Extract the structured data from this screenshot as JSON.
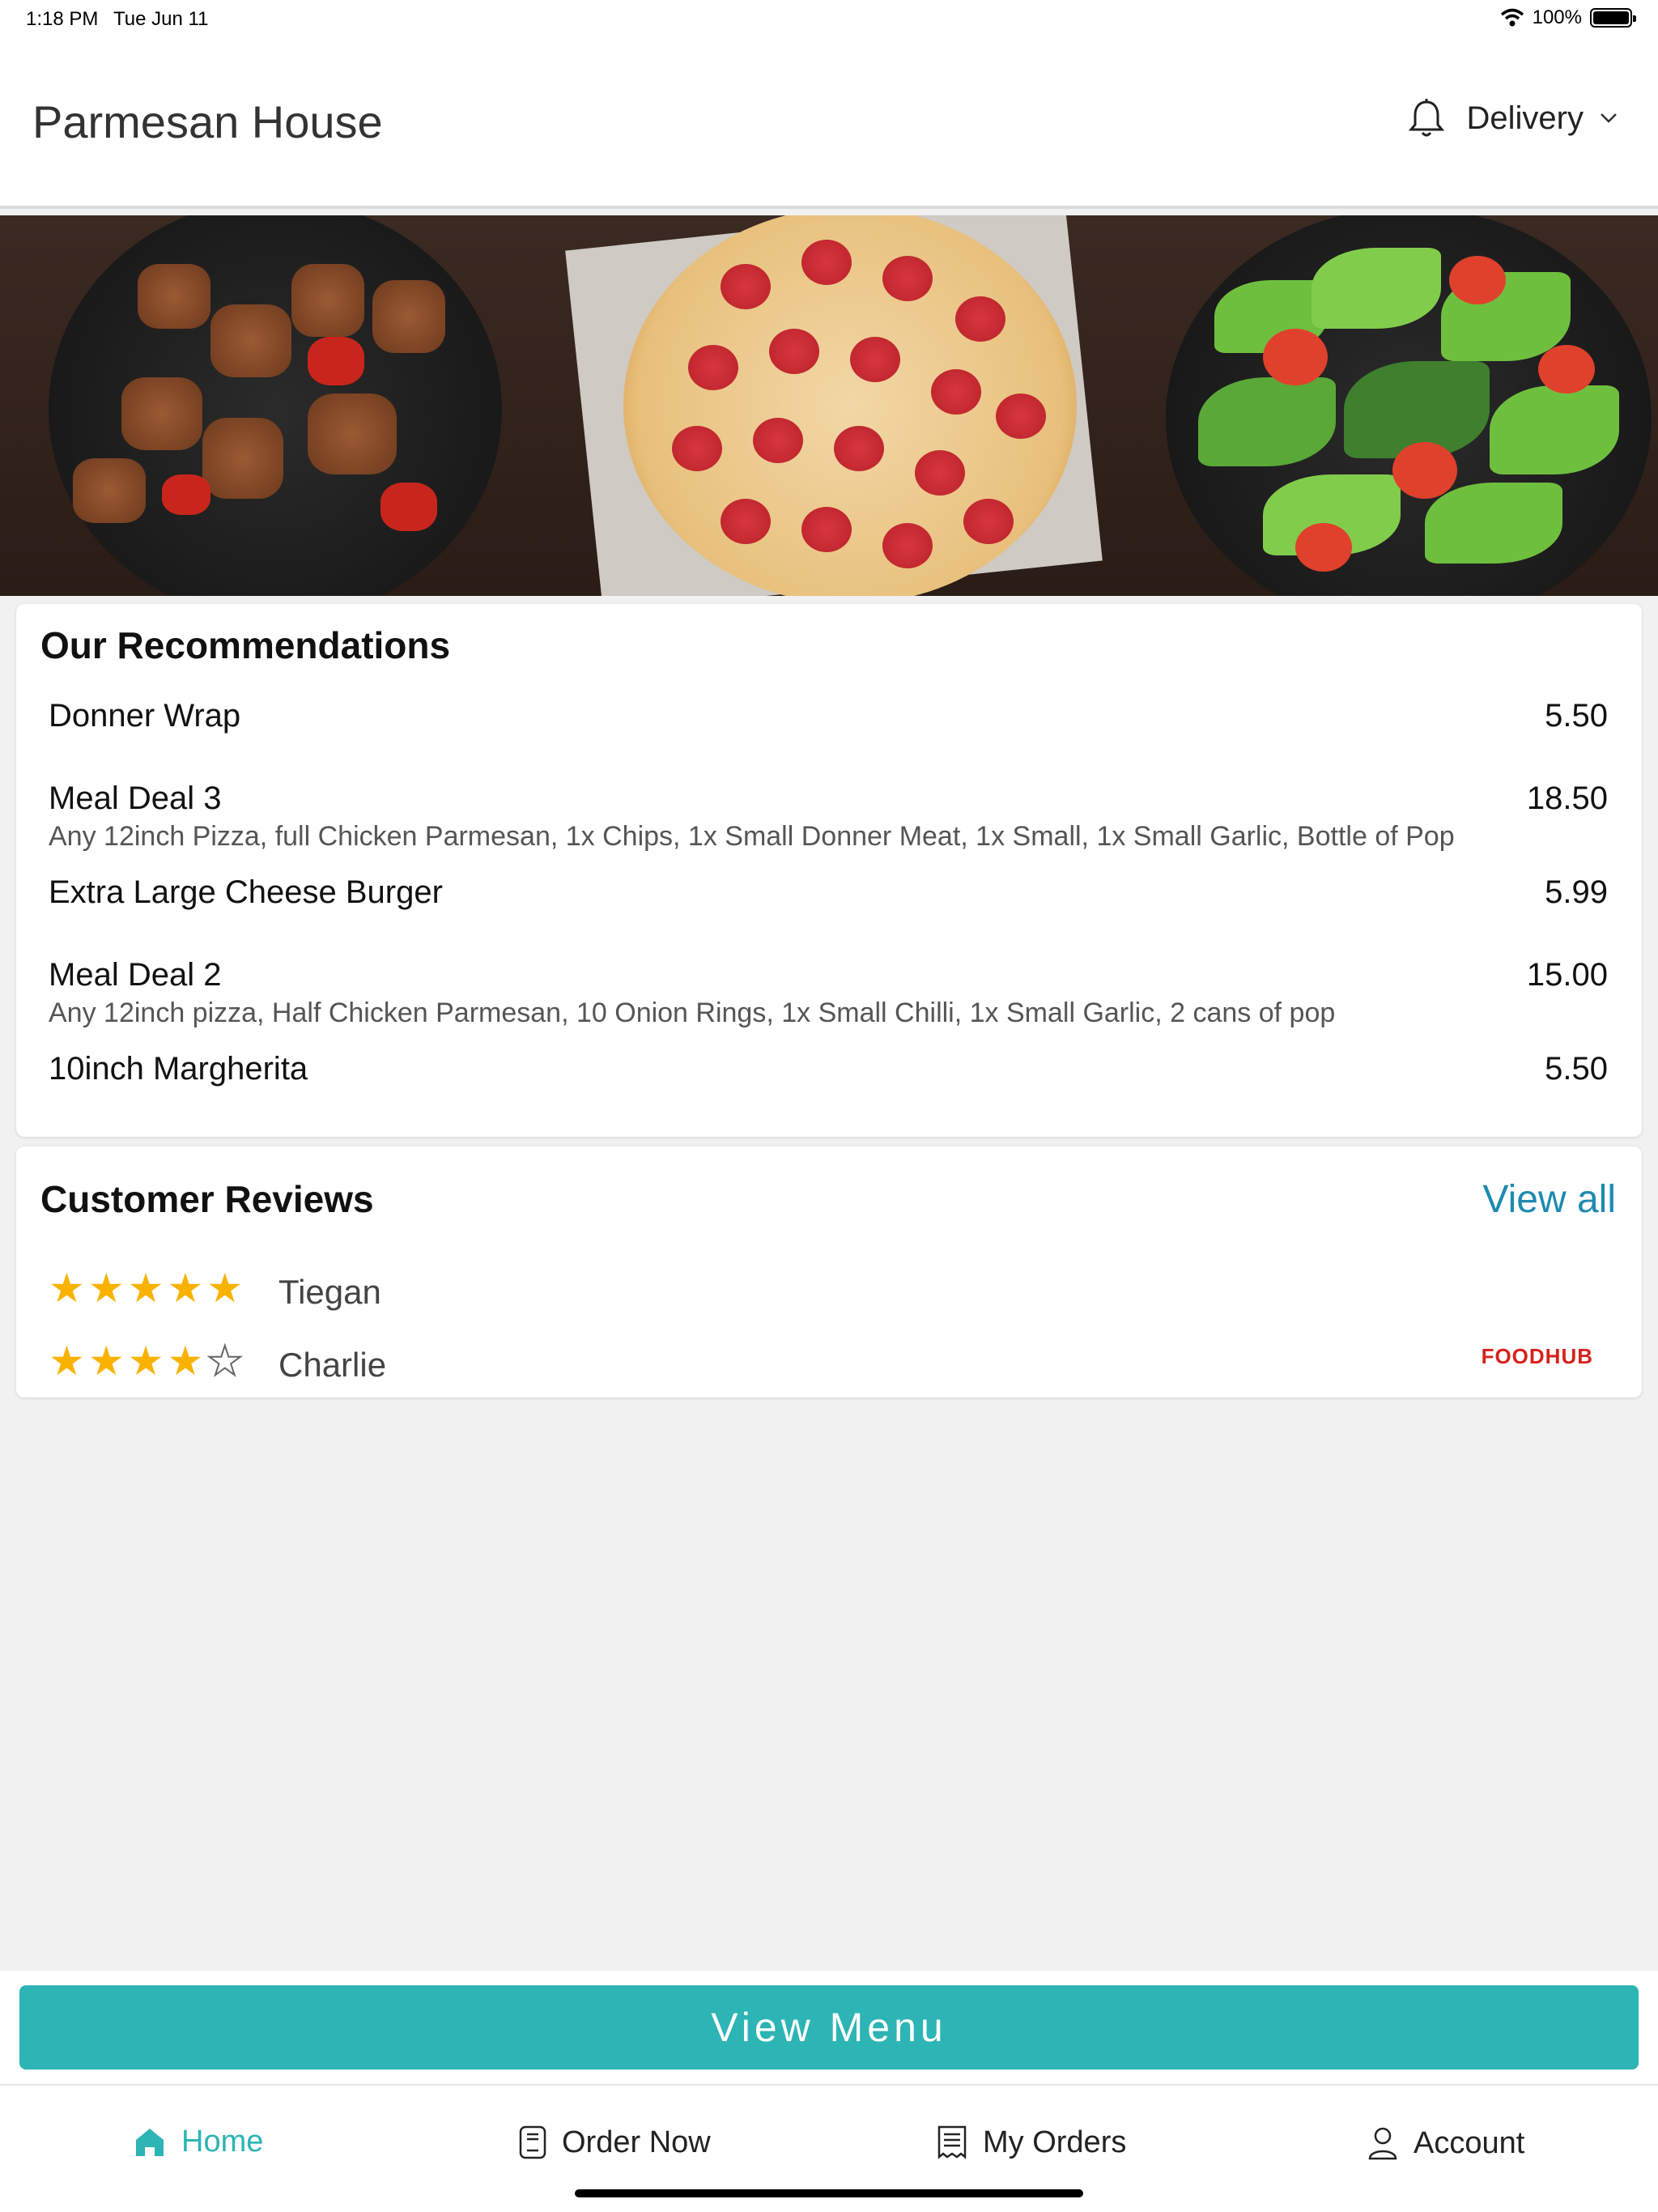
{
  "status_bar": {
    "time": "1:18 PM",
    "date": "Tue Jun 11",
    "battery": "100%"
  },
  "header": {
    "title": "Parmesan House",
    "mode": "Delivery",
    "icons": [
      "bell-icon",
      "chevron-down-icon"
    ]
  },
  "banner": {
    "dishes": [
      "kebab-skewers",
      "pepperoni-pizza",
      "salad"
    ]
  },
  "recommendations": {
    "title": "Our Recommendations",
    "items": [
      {
        "name": "Donner Wrap",
        "price": "5.50",
        "desc": ""
      },
      {
        "name": "Meal Deal 3",
        "price": "18.50",
        "desc": "Any 12inch Pizza, full Chicken Parmesan, 1x Chips, 1x Small Donner Meat, 1x Small, 1x Small Garlic, Bottle of Pop"
      },
      {
        "name": "Extra Large Cheese Burger",
        "price": "5.99",
        "desc": ""
      },
      {
        "name": "Meal Deal 2",
        "price": "15.00",
        "desc": "Any 12inch pizza, Half Chicken Parmesan, 10 Onion Rings, 1x Small Chilli, 1x Small Garlic, 2 cans of pop"
      },
      {
        "name": "10inch Margherita",
        "price": "5.50",
        "desc": ""
      }
    ]
  },
  "reviews": {
    "title": "Customer Reviews",
    "view_all": "View all",
    "items": [
      {
        "name": "Tiegan",
        "rating": 5
      },
      {
        "name": "Charlie",
        "rating": 4
      }
    ],
    "brand": "FOODHUB"
  },
  "view_menu_button": "View Menu",
  "tabs": [
    {
      "label": "Home",
      "icon": "home-icon",
      "active": true
    },
    {
      "label": "Order Now",
      "icon": "order-icon",
      "active": false
    },
    {
      "label": "My Orders",
      "icon": "receipt-icon",
      "active": false
    },
    {
      "label": "Account",
      "icon": "user-icon",
      "active": false
    }
  ],
  "colors": {
    "accent": "#2db4b4",
    "link": "#1e8ab0",
    "star": "#f9b200",
    "brand": "#d6221d"
  }
}
